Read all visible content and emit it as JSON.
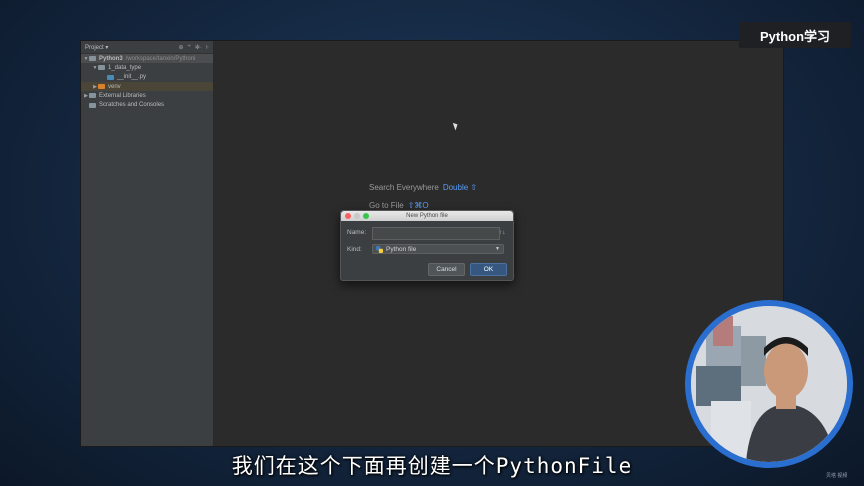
{
  "sidebar": {
    "header_label": "Project ▾",
    "tools": [
      "⊕",
      "÷",
      "✻·",
      "⊦"
    ],
    "tree": [
      {
        "arrow": "▼",
        "label": "Python3",
        "path": "/workspace/tanxin/Pythoni",
        "color": "#87939a",
        "state": "sel",
        "indent": 0
      },
      {
        "arrow": "▼",
        "label": "1_data_type",
        "color": "#87939a",
        "state": "",
        "indent": 1
      },
      {
        "arrow": "",
        "label": "__init__.py",
        "color": "#4a8ab5",
        "state": "",
        "indent": 2
      },
      {
        "arrow": "▶",
        "label": "venv",
        "color": "#d9822b",
        "state": "hl",
        "indent": 1
      },
      {
        "arrow": "▶",
        "label": "External Libraries",
        "color": "#87939a",
        "state": "",
        "indent": 0
      },
      {
        "arrow": "",
        "label": "Scratches and Consoles",
        "color": "#87939a",
        "state": "",
        "indent": 0
      }
    ]
  },
  "editor": {
    "search_label": "Search Everywhere",
    "search_key": "Double ⇧",
    "goto_label": "Go to File",
    "goto_key": "⇧⌘O"
  },
  "dialog": {
    "title": "New Python file",
    "name_label": "Name:",
    "name_value": "",
    "sort_icon": "↑↓",
    "kind_label": "Kind:",
    "kind_value": "Python file",
    "cancel_label": "Cancel",
    "ok_label": "OK"
  },
  "brand": "Python学习",
  "subtitle": "我们在这个下面再创建一个PythonFile",
  "watermark": "贝塔 视频",
  "colors": {
    "accent": "#589df6",
    "ok_button": "#365880",
    "avatar_ring": "#2a6fd0"
  }
}
